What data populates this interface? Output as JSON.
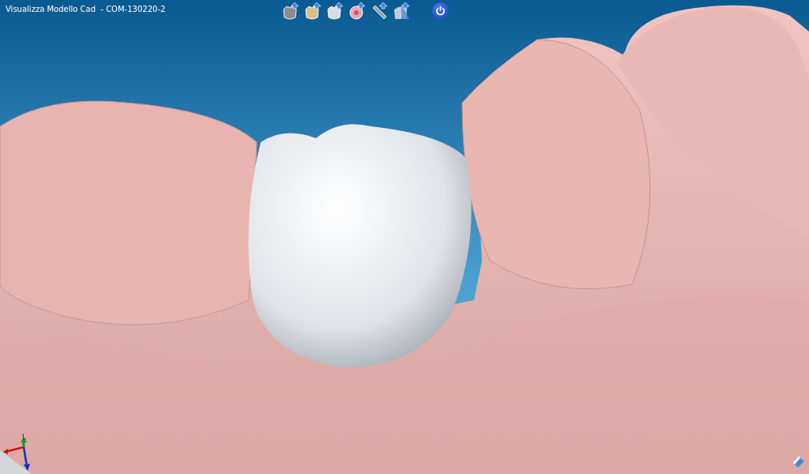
{
  "window": {
    "title": "Visualizza Modello Cad  - COM-130220-2"
  },
  "toolbar": {
    "tools": [
      {
        "kind": "grey"
      },
      {
        "kind": "gold"
      },
      {
        "kind": "white"
      },
      {
        "kind": "ring"
      },
      {
        "kind": "bar"
      },
      {
        "kind": "cut"
      }
    ]
  },
  "axes": {
    "label": "L"
  }
}
